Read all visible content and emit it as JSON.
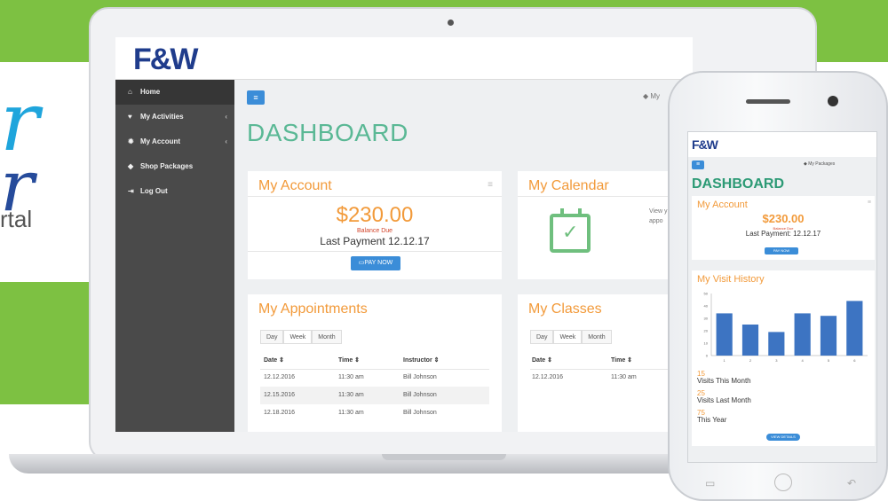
{
  "hero": {
    "big_letter": "r",
    "big_letter2": "r",
    "subtitle": "rtal"
  },
  "brand": {
    "logo": "F&W",
    "logo_mobile": "F&W"
  },
  "sidebar": {
    "items": [
      {
        "label": "Home",
        "icon": "home-icon",
        "glyph": "⌂"
      },
      {
        "label": "My Activities",
        "icon": "heart-icon",
        "glyph": "♥"
      },
      {
        "label": "My Account",
        "icon": "gear-icon",
        "glyph": "✹"
      },
      {
        "label": "Shop Packages",
        "icon": "tag-icon",
        "glyph": "◆"
      },
      {
        "label": "Log Out",
        "icon": "logout-icon",
        "glyph": "⇥"
      }
    ]
  },
  "topbar": {
    "breadcrumb": "My"
  },
  "dashboard": {
    "title": "DASHBOARD"
  },
  "account": {
    "title": "My Account",
    "balance": "$230.00",
    "balance_label": "Balance Due",
    "last_payment": "Last Payment 12.12.17",
    "pay_button": "PAY NOW"
  },
  "calendar": {
    "title": "My Calendar",
    "note": "View y appo"
  },
  "appointments": {
    "title": "My Appointments",
    "tabs": [
      "Day",
      "Week",
      "Month"
    ],
    "columns": [
      "Date ⇕",
      "Time ⇕",
      "Instructor ⇕"
    ],
    "rows": [
      [
        "12.12.2016",
        "11:30 am",
        "Bill Johnson"
      ],
      [
        "12.15.2016",
        "11:30 am",
        "Bill Johnson"
      ],
      [
        "12.18.2016",
        "11:30 am",
        "Bill Johnson"
      ]
    ]
  },
  "classes": {
    "title": "My Classes",
    "tabs": [
      "Day",
      "Week",
      "Month"
    ],
    "columns": [
      "Date ⇕",
      "Time ⇕"
    ],
    "rows": [
      [
        "12.12.2016",
        "11:30 am"
      ]
    ]
  },
  "mobile": {
    "breadcrumb": "My Packages",
    "title": "DASHBOARD",
    "account": {
      "title": "My Account",
      "balance": "$230.00",
      "balance_label": "Balance Due",
      "last_payment": "Last Payment: 12.12.17",
      "pay_button": "PAY NOW"
    },
    "visit_history": {
      "title": "My Visit History",
      "stats": [
        {
          "num": "15",
          "label": "Visits This Month"
        },
        {
          "num": "25",
          "label": "Visits Last Month"
        },
        {
          "num": "75",
          "label": "This Year"
        }
      ],
      "view_button": "VIEW DETAILS"
    }
  },
  "chart_data": {
    "type": "bar",
    "categories": [
      "1",
      "2",
      "3",
      "4",
      "5",
      "6"
    ],
    "values": [
      34,
      25,
      19,
      34,
      32,
      44
    ],
    "ylim": [
      0,
      50
    ],
    "yticks": [
      "0",
      "10",
      "20",
      "30",
      "40",
      "50"
    ],
    "title": "",
    "xlabel": "",
    "ylabel": "",
    "color": "#3d74c2",
    "grid": false
  },
  "colors": {
    "accent_green": "#7dc142",
    "brand_blue": "#1f3c8c",
    "orange": "#f29a3a",
    "teal": "#5ab895",
    "button_blue": "#3b8dd8"
  }
}
